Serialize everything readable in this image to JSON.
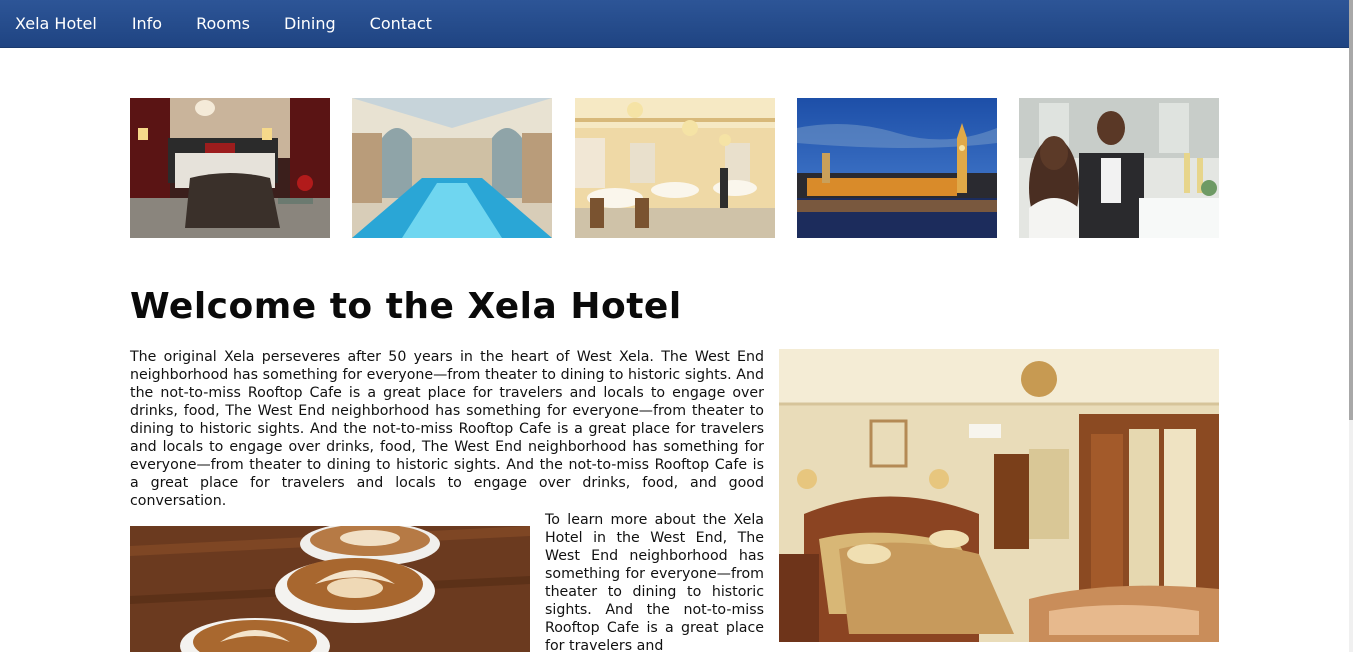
{
  "nav": {
    "brand": "Xela Hotel",
    "links": [
      "Info",
      "Rooms",
      "Dining",
      "Contact"
    ]
  },
  "gallery": [
    {
      "icon": "bedroom-photo"
    },
    {
      "icon": "pool-photo"
    },
    {
      "icon": "ballroom-photo"
    },
    {
      "icon": "london-parliament-photo"
    },
    {
      "icon": "couple-dining-photo"
    }
  ],
  "main": {
    "title": "Welcome to the Xela Hotel",
    "intro": "The original Xela perseveres after 50 years in the heart of West Xela. The West End neighborhood has something for everyone—from theater to dining to historic sights. And the not-to-miss Rooftop Cafe is a great place for travelers and locals to engage over drinks, food, The West End neighborhood has something for everyone—from theater to dining to historic sights. And the not-to-miss Rooftop Cafe is a great place for travelers and locals to engage over drinks, food, The West End neighborhood has something for everyone—from theater to dining to historic sights. And the not-to-miss Rooftop Cafe is a great place for travelers and locals to engage over drinks, food, and good conversation.",
    "side_text": " To learn more about the Xela Hotel in the West End, The West End neighborhood has something for everyone—from theater to dining to historic sights. And the not-to-miss Rooftop Cafe is a great place for travelers and"
  },
  "colors": {
    "nav_bg": "#2a5091",
    "nav_text": "#ffffff",
    "page_bg": "#ffffff"
  }
}
